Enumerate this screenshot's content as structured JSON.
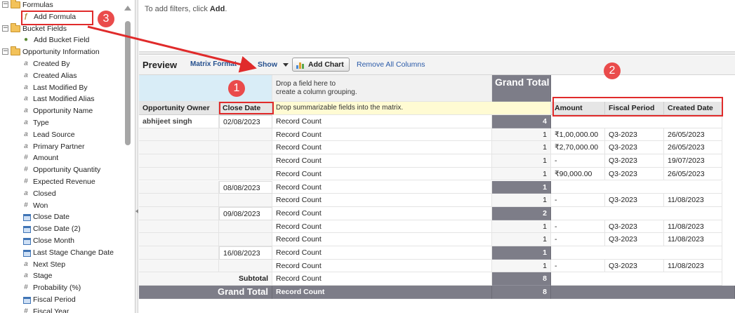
{
  "field_tree": [
    {
      "label": "Formulas",
      "kind": "folder",
      "toggle": "−",
      "level": 0
    },
    {
      "label": "Add Formula",
      "kind": "formula",
      "level": 1
    },
    {
      "label": "Bucket Fields",
      "kind": "folder",
      "toggle": "−",
      "level": 0
    },
    {
      "label": "Add Bucket Field",
      "kind": "bucket",
      "level": 1
    },
    {
      "label": "Opportunity Information",
      "kind": "folder",
      "toggle": "−",
      "level": 0
    },
    {
      "label": "Created By",
      "kind": "text",
      "level": 1
    },
    {
      "label": "Created Alias",
      "kind": "text",
      "level": 1
    },
    {
      "label": "Last Modified By",
      "kind": "text",
      "level": 1
    },
    {
      "label": "Last Modified Alias",
      "kind": "text",
      "level": 1
    },
    {
      "label": "Opportunity Name",
      "kind": "text",
      "level": 1
    },
    {
      "label": "Type",
      "kind": "text",
      "level": 1
    },
    {
      "label": "Lead Source",
      "kind": "text",
      "level": 1
    },
    {
      "label": "Primary Partner",
      "kind": "text",
      "level": 1
    },
    {
      "label": "Amount",
      "kind": "number",
      "level": 1
    },
    {
      "label": "Opportunity Quantity",
      "kind": "number",
      "level": 1
    },
    {
      "label": "Expected Revenue",
      "kind": "number",
      "level": 1
    },
    {
      "label": "Closed",
      "kind": "text",
      "level": 1
    },
    {
      "label": "Won",
      "kind": "number",
      "level": 1
    },
    {
      "label": "Close Date",
      "kind": "date",
      "level": 1
    },
    {
      "label": "Close Date (2)",
      "kind": "date",
      "level": 1
    },
    {
      "label": "Close Month",
      "kind": "date",
      "level": 1
    },
    {
      "label": "Last Stage Change Date",
      "kind": "date",
      "level": 1
    },
    {
      "label": "Next Step",
      "kind": "text",
      "level": 1
    },
    {
      "label": "Stage",
      "kind": "text",
      "level": 1
    },
    {
      "label": "Probability (%)",
      "kind": "number",
      "level": 1
    },
    {
      "label": "Fiscal Period",
      "kind": "date",
      "level": 1
    },
    {
      "label": "Fiscal Year",
      "kind": "number",
      "level": 1
    }
  ],
  "icons": {
    "text": "a",
    "number": "#",
    "formula": "ƒ",
    "bucket": "●"
  },
  "filters": {
    "prefix": "To add filters, click ",
    "action": "Add",
    "suffix": "."
  },
  "toolbar": {
    "title": "Preview",
    "format_label": "Matrix Format",
    "show_label": "Show",
    "add_chart_label": "Add Chart",
    "remove_columns_label": "Remove All Columns"
  },
  "matrix": {
    "column_drop_hint_line1": "Drop a field here to",
    "column_drop_hint_line2": "create a column grouping.",
    "grand_total_header": "Grand Total",
    "row_group_headers": [
      "Opportunity Owner",
      "Close Date"
    ],
    "summary_drop_hint": "Drop summarizable fields into the matrix.",
    "detail_columns": [
      "Amount",
      "Fiscal Period",
      "Created Date"
    ],
    "owner": "abhijeet singh",
    "record_count_label": "Record Count",
    "rows": [
      {
        "type": "group",
        "date": "02/08/2023",
        "count": "4"
      },
      {
        "type": "detail",
        "count": "1",
        "amount": "₹1,00,000.00",
        "period": "Q3-2023",
        "created": "26/05/2023"
      },
      {
        "type": "detail",
        "count": "1",
        "amount": "₹2,70,000.00",
        "period": "Q3-2023",
        "created": "26/05/2023"
      },
      {
        "type": "detail",
        "count": "1",
        "amount": "-",
        "period": "Q3-2023",
        "created": "19/07/2023"
      },
      {
        "type": "detail",
        "count": "1",
        "amount": "₹90,000.00",
        "period": "Q3-2023",
        "created": "26/05/2023"
      },
      {
        "type": "group",
        "date": "08/08/2023",
        "count": "1"
      },
      {
        "type": "detail",
        "count": "1",
        "amount": "-",
        "period": "Q3-2023",
        "created": "11/08/2023"
      },
      {
        "type": "group",
        "date": "09/08/2023",
        "count": "2"
      },
      {
        "type": "detail",
        "count": "1",
        "amount": "-",
        "period": "Q3-2023",
        "created": "11/08/2023"
      },
      {
        "type": "detail",
        "count": "1",
        "amount": "-",
        "period": "Q3-2023",
        "created": "11/08/2023"
      },
      {
        "type": "group",
        "date": "16/08/2023",
        "count": "1"
      },
      {
        "type": "detail",
        "count": "1",
        "amount": "-",
        "period": "Q3-2023",
        "created": "11/08/2023"
      }
    ],
    "subtotal_label": "Subtotal",
    "subtotal_count": "8",
    "grand_total_label": "Grand Total",
    "grand_total_count": "8"
  },
  "annotations": {
    "callout_1": "1",
    "callout_2": "2",
    "callout_3": "3",
    "color": "#e02b2b"
  }
}
